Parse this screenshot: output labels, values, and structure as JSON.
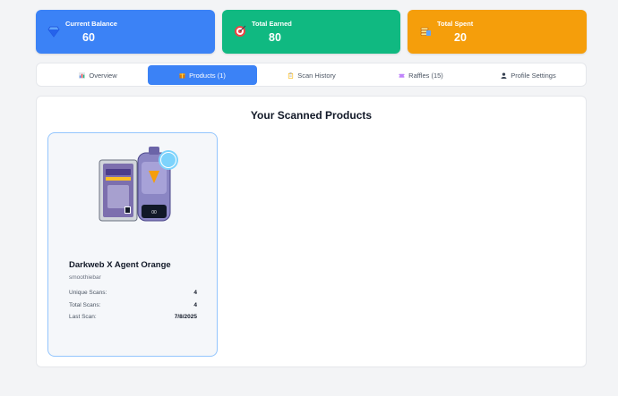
{
  "stats": [
    {
      "label": "Current Balance",
      "value": "60",
      "icon": "gem-icon",
      "color": "#3b82f6"
    },
    {
      "label": "Total Earned",
      "value": "80",
      "icon": "target-icon",
      "color": "#10b981"
    },
    {
      "label": "Total Spent",
      "value": "20",
      "icon": "coins-icon",
      "color": "#f59e0b"
    }
  ],
  "tabs": [
    {
      "label": "Overview",
      "icon": "bar-chart-icon",
      "active": false
    },
    {
      "label": "Products (1)",
      "icon": "package-icon",
      "active": true
    },
    {
      "label": "Scan History",
      "icon": "clipboard-icon",
      "active": false
    },
    {
      "label": "Raffles (15)",
      "icon": "ticket-icon",
      "active": false
    },
    {
      "label": "Profile Settings",
      "icon": "user-icon",
      "active": false
    }
  ],
  "main": {
    "title": "Your Scanned Products",
    "products": [
      {
        "name": "Darkweb X Agent Orange",
        "brand": "smoothiebar",
        "image_icon": "vape-product-image",
        "stats": [
          {
            "label": "Unique Scans:",
            "value": "4"
          },
          {
            "label": "Total Scans:",
            "value": "4"
          },
          {
            "label": "Last Scan:",
            "value": "7/8/2025"
          }
        ]
      }
    ]
  }
}
